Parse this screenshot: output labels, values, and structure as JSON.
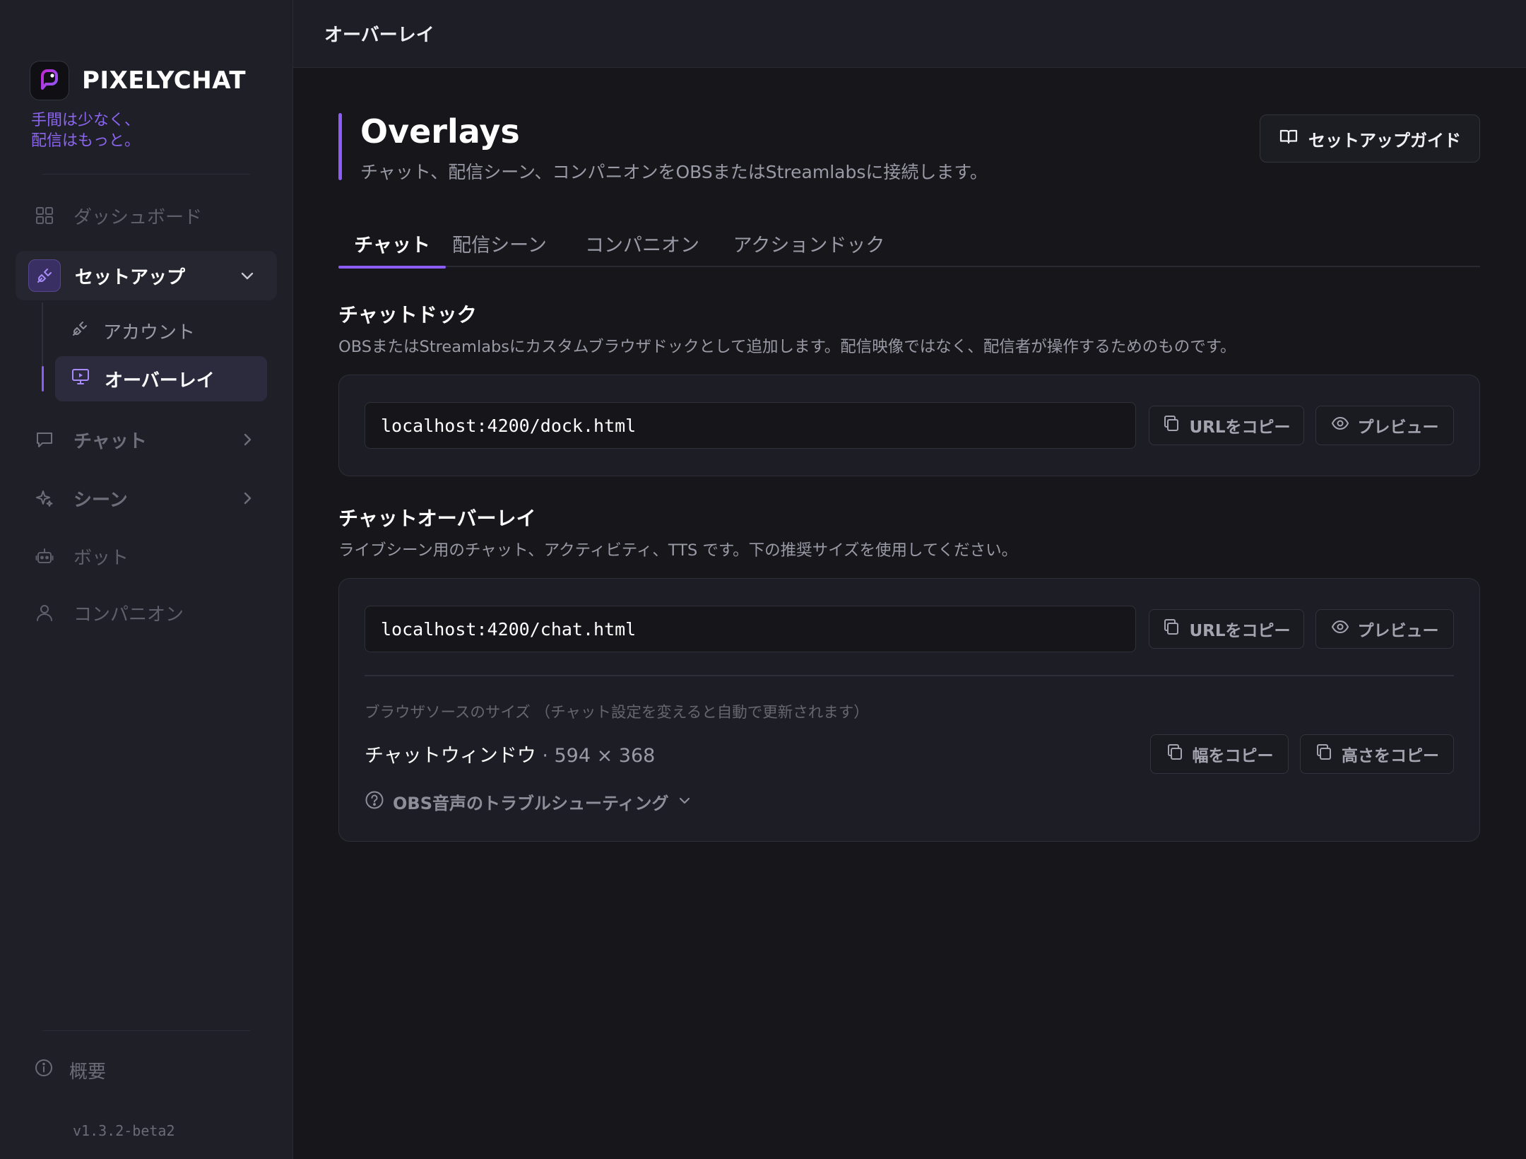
{
  "brand": {
    "name": "PIXELYCHAT",
    "tagline_line1": "手間は少なく、",
    "tagline_line2": "配信はもっと。",
    "accent_color": "#8b5cf6"
  },
  "sidebar": {
    "items": [
      {
        "label": "ダッシュボード",
        "icon": "grid-icon"
      },
      {
        "label": "セットアップ",
        "icon": "plug-icon",
        "expanded": true
      },
      {
        "label": "チャット",
        "icon": "chat-bubble-icon"
      },
      {
        "label": "シーン",
        "icon": "sparkle-icon"
      },
      {
        "label": "ボット",
        "icon": "bot-icon"
      },
      {
        "label": "コンパニオン",
        "icon": "user-icon"
      }
    ],
    "sub_items": [
      {
        "label": "アカウント",
        "icon": "plug-icon"
      },
      {
        "label": "オーバーレイ",
        "icon": "monitor-icon",
        "active": true
      }
    ],
    "about_label": "概要",
    "version": "v1.3.2-beta2"
  },
  "topbar": {
    "title": "オーバーレイ"
  },
  "page": {
    "title": "Overlays",
    "subtitle": "チャット、配信シーン、コンパニオンをOBSまたはStreamlabsに接続します。",
    "guide_button": "セットアップガイド"
  },
  "tabs": [
    {
      "label": "チャット",
      "active": true
    },
    {
      "label": "配信シーン"
    },
    {
      "label": "コンパニオン"
    },
    {
      "label": "アクションドック"
    }
  ],
  "dock": {
    "title": "チャットドック",
    "description": "OBSまたはStreamlabsにカスタムブラウザドックとして追加します。配信映像ではなく、配信者が操作するためのものです。",
    "url": "localhost:4200/dock.html",
    "copy_label": "URLをコピー",
    "preview_label": "プレビュー"
  },
  "overlay": {
    "title": "チャットオーバーレイ",
    "description": "ライブシーン用のチャット、アクティビティ、TTS です。下の推奨サイズを使用してください。",
    "url": "localhost:4200/chat.html",
    "copy_label": "URLをコピー",
    "preview_label": "プレビュー",
    "size_hint": "ブラウザソースのサイズ （チャット設定を変えると自動で更新されます）",
    "window_label": "チャットウィンドウ",
    "window_dims": " · 594 × 368",
    "copy_width": "幅をコピー",
    "copy_height": "高さをコピー",
    "troubleshoot": "OBS音声のトラブルシューティング"
  }
}
